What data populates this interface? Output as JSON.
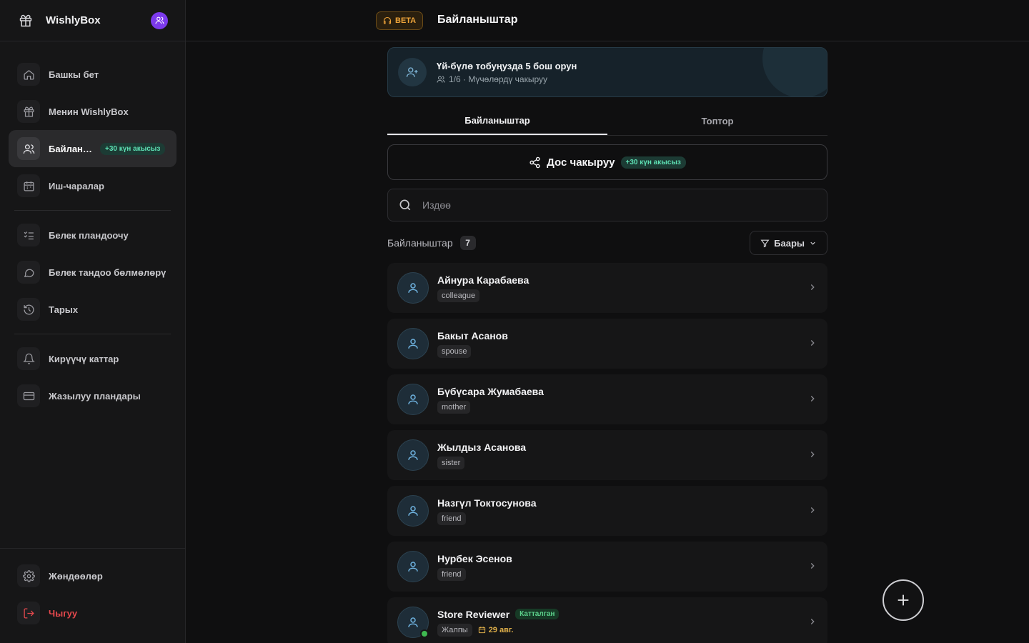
{
  "app": {
    "name": "WishlyBox"
  },
  "header": {
    "beta_label": "BETA",
    "title": "Байланыштар"
  },
  "sidebar": {
    "items": [
      {
        "label": "Башкы бет",
        "icon": "home-icon"
      },
      {
        "label": "Менин WishlyBox",
        "icon": "gift-icon"
      },
      {
        "label": "Байланыштар",
        "icon": "users-icon",
        "active": true,
        "badge": "+30 күн акысыз"
      },
      {
        "label": "Иш-чаралар",
        "icon": "calendar-icon"
      },
      {
        "label": "Белек пландоочу",
        "icon": "checklist-icon"
      },
      {
        "label": "Белек тандоо бөлмөлөрү",
        "icon": "chat-icon"
      },
      {
        "label": "Тарых",
        "icon": "history-icon"
      },
      {
        "label": "Кирүүчү каттар",
        "icon": "bell-icon"
      },
      {
        "label": "Жазылуу пландары",
        "icon": "card-icon"
      }
    ],
    "bottom": [
      {
        "label": "Жөндөөлөр",
        "icon": "gear-icon"
      },
      {
        "label": "Чыгуу",
        "icon": "logout-icon"
      }
    ]
  },
  "family_banner": {
    "title": "Үй-бүлө тобуңузда 5 бош орун",
    "subtitle": "1/6 · Мүчөлөрдү чакыруу"
  },
  "tabs": [
    {
      "label": "Байланыштар",
      "active": true
    },
    {
      "label": "Топтор",
      "active": false
    }
  ],
  "invite": {
    "label": "Дос чакыруу",
    "badge": "+30 күн акысыз"
  },
  "search": {
    "placeholder": "Издөө",
    "value": ""
  },
  "list": {
    "title": "Байланыштар",
    "count": "7",
    "filter_label": "Баары"
  },
  "contacts": [
    {
      "name": "Айнура Карабаева",
      "relation": "colleague"
    },
    {
      "name": "Бакыт Асанов",
      "relation": "spouse"
    },
    {
      "name": "Бүбүсара Жумабаева",
      "relation": "mother"
    },
    {
      "name": "Жылдыз Асанова",
      "relation": "sister"
    },
    {
      "name": "Назгүл Токтосунова",
      "relation": "friend"
    },
    {
      "name": "Нурбек Эсенов",
      "relation": "friend"
    },
    {
      "name": "Store Reviewer",
      "relation": "Жалпы",
      "status": "Катталган",
      "date": "29 авг.",
      "online": true
    }
  ],
  "colors": {
    "background": "#0f0f10",
    "sidebar": "#161617",
    "accent_purple": "#7c3aed",
    "promo_green": "#5ee0b4",
    "beta_orange": "#f0a53a",
    "logout_red": "#e5484d",
    "avatar_blue": "#6fb3e0"
  }
}
